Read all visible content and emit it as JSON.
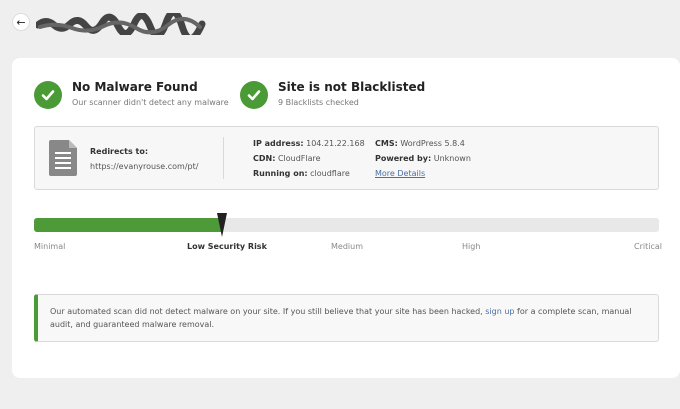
{
  "header": {
    "back_icon": "arrow-left-icon"
  },
  "status": [
    {
      "title": "No Malware Found",
      "subtitle": "Our scanner didn't detect any malware",
      "icon": "check-circle-icon"
    },
    {
      "title": "Site is not Blacklisted",
      "subtitle": "9 Blacklists checked",
      "icon": "check-circle-icon"
    }
  ],
  "info": {
    "redirects_label": "Redirects to:",
    "redirects_url": "https://evanyrouse.com/pt/",
    "ip_label": "IP address:",
    "ip_value": "104.21.22.168",
    "cdn_label": "CDN:",
    "cdn_value": "CloudFlare",
    "running_label": "Running on:",
    "running_value": "cloudflare",
    "cms_label": "CMS:",
    "cms_value": "WordPress 5.8.4",
    "powered_label": "Powered by:",
    "powered_value": "Unknown",
    "more_details": "More Details"
  },
  "risk": {
    "level_fraction": 0.3,
    "levels": [
      "Minimal",
      "Low Security Risk",
      "Medium",
      "High",
      "Critical"
    ],
    "active_index": 1
  },
  "notice": {
    "text_before": "Our automated scan did not detect malware on your site. If you still believe that your site has been hacked,",
    "link": "sign up",
    "text_after": "for a complete scan, manual audit, and guaranteed malware removal."
  },
  "colors": {
    "success": "#4a9a36",
    "link": "#4a6fa5",
    "bar": "#4f9a38"
  }
}
